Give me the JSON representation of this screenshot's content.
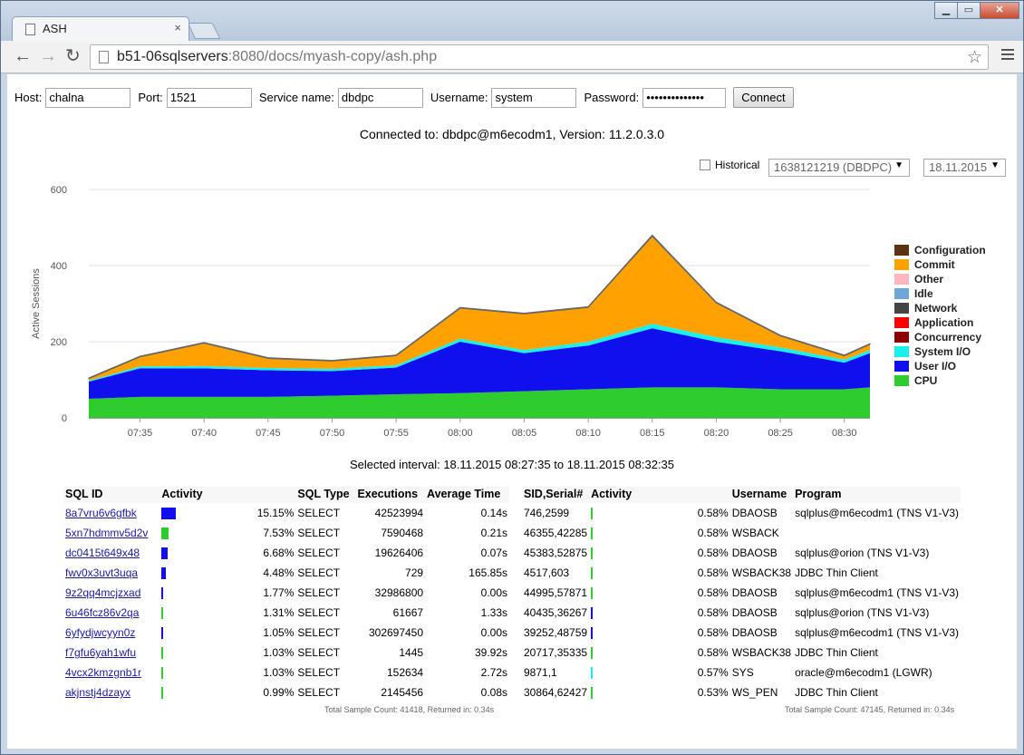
{
  "browser": {
    "tab_title": "ASH",
    "tab_close": "×",
    "url_host": "b51-06sqlservers",
    "url_rest": ":8080/docs/myash-copy/ash.php",
    "back": "←",
    "forward": "→",
    "reload": "↻",
    "star": "☆",
    "win_min": "▁",
    "win_max": "▭",
    "win_close": "✕"
  },
  "form": {
    "host_label": "Host:",
    "host_value": "chalna",
    "port_label": "Port:",
    "port_value": "1521",
    "service_label": "Service name:",
    "service_value": "dbdpc",
    "username_label": "Username:",
    "username_value": "system",
    "password_label": "Password:",
    "password_value": "••••••••••••••",
    "connect_label": "Connect"
  },
  "connection_text": "Connected to: dbdpc@m6ecodm1, Version: 11.2.0.3.0",
  "historical_label": "Historical",
  "dbid_select": "1638121219 (DBDPC)",
  "date_select": "18.11.2015",
  "select_arrow": "▼",
  "colors": {
    "cpu": "#2ecc2e",
    "user_io": "#1010ee",
    "system_io": "#19f0ee",
    "concurrency": "#8b0000",
    "application": "#ff0000",
    "network": "#444444",
    "idle": "#6ea6dc",
    "other": "#ffb6c1",
    "commit": "#ffa100",
    "configuration": "#5c3311"
  },
  "chart_data": {
    "type": "area",
    "ylabel": "Active Sessions",
    "ylim": [
      0,
      600
    ],
    "yticks": [
      "600",
      "400",
      "200",
      "0"
    ],
    "xticks": [
      "07:35",
      "07:40",
      "07:45",
      "07:50",
      "07:55",
      "08:00",
      "08:05",
      "08:10",
      "08:15",
      "08:20",
      "08:25",
      "08:30"
    ],
    "x_start": "07:31",
    "x_end": "08:32",
    "legend": [
      "Configuration",
      "Commit",
      "Other",
      "Idle",
      "Network",
      "Application",
      "Concurrency",
      "System I/O",
      "User I/O",
      "CPU"
    ],
    "series": [
      {
        "name": "CPU",
        "color": "#2ecc2e",
        "x": [
          "07:31",
          "07:35",
          "07:40",
          "07:45",
          "07:50",
          "07:55",
          "08:00",
          "08:05",
          "08:10",
          "08:15",
          "08:20",
          "08:25",
          "08:30",
          "08:32"
        ],
        "values": [
          50,
          55,
          55,
          55,
          58,
          62,
          65,
          70,
          75,
          80,
          80,
          75,
          75,
          80
        ]
      },
      {
        "name": "User I/O",
        "color": "#1010ee",
        "x": [
          "07:31",
          "07:35",
          "07:40",
          "07:45",
          "07:50",
          "07:55",
          "08:00",
          "08:05",
          "08:10",
          "08:15",
          "08:20",
          "08:25",
          "08:30",
          "08:32"
        ],
        "values": [
          45,
          75,
          75,
          70,
          65,
          70,
          135,
          100,
          115,
          155,
          120,
          100,
          70,
          90
        ]
      },
      {
        "name": "System I/O",
        "color": "#19f0ee",
        "x": [
          "07:31",
          "07:35",
          "07:40",
          "07:45",
          "07:50",
          "07:55",
          "08:00",
          "08:05",
          "08:10",
          "08:15",
          "08:20",
          "08:25",
          "08:30",
          "08:32"
        ],
        "values": [
          3,
          5,
          6,
          6,
          6,
          6,
          8,
          8,
          10,
          12,
          12,
          10,
          8,
          8
        ]
      },
      {
        "name": "Commit",
        "color": "#ffa100",
        "x": [
          "07:31",
          "07:35",
          "07:40",
          "07:45",
          "07:50",
          "07:55",
          "08:00",
          "08:05",
          "08:10",
          "08:15",
          "08:20",
          "08:25",
          "08:30",
          "08:32"
        ],
        "values": [
          5,
          25,
          60,
          25,
          20,
          25,
          80,
          95,
          90,
          230,
          90,
          30,
          10,
          15
        ]
      },
      {
        "name": "Configuration",
        "color": "#5c3311",
        "x": [
          "07:31",
          "07:35",
          "07:40",
          "07:45",
          "07:50",
          "07:55",
          "08:00",
          "08:05",
          "08:10",
          "08:15",
          "08:20",
          "08:25",
          "08:30",
          "08:32"
        ],
        "values": [
          2,
          2,
          2,
          2,
          2,
          2,
          2,
          2,
          2,
          3,
          2,
          2,
          2,
          2
        ]
      }
    ]
  },
  "interval_text": "Selected interval: 18.11.2015 08:27:35 to 18.11.2015 08:32:35",
  "sql_table": {
    "headers": [
      "SQL ID",
      "Activity",
      "",
      "SQL Type",
      "Executions",
      "Average Time"
    ],
    "rows": [
      {
        "id": "8a7vru6v6gfbk",
        "pct": 15.15,
        "pct_text": "15.15%",
        "type": "SELECT",
        "exec": "42523994",
        "avg": "0.14s",
        "color": "#1010ee"
      },
      {
        "id": "5xn7hdmmv5d2v",
        "pct": 7.53,
        "pct_text": "7.53%",
        "type": "SELECT",
        "exec": "7590468",
        "avg": "0.21s",
        "color": "#2ecc2e"
      },
      {
        "id": "dc0415t649x48",
        "pct": 6.68,
        "pct_text": "6.68%",
        "type": "SELECT",
        "exec": "19626406",
        "avg": "0.07s",
        "color": "#1010ee"
      },
      {
        "id": "fwv0x3uvt3uqa",
        "pct": 4.48,
        "pct_text": "4.48%",
        "type": "SELECT",
        "exec": "729",
        "avg": "165.85s",
        "color": "#1010ee"
      },
      {
        "id": "9z2qq4mcjzxad",
        "pct": 1.77,
        "pct_text": "1.77%",
        "type": "SELECT",
        "exec": "32986800",
        "avg": "0.00s",
        "color": "#1010ee"
      },
      {
        "id": "6u46fcz86v2qa",
        "pct": 1.31,
        "pct_text": "1.31%",
        "type": "SELECT",
        "exec": "61667",
        "avg": "1.33s",
        "color": "#2ecc2e"
      },
      {
        "id": "6yfydjwcyyn0z",
        "pct": 1.05,
        "pct_text": "1.05%",
        "type": "SELECT",
        "exec": "302697450",
        "avg": "0.00s",
        "color": "#1010ee"
      },
      {
        "id": "f7gfu6yah1wfu",
        "pct": 1.03,
        "pct_text": "1.03%",
        "type": "SELECT",
        "exec": "1445",
        "avg": "39.92s",
        "color": "#2ecc2e"
      },
      {
        "id": "4vcx2kmzgnb1r",
        "pct": 1.03,
        "pct_text": "1.03%",
        "type": "SELECT",
        "exec": "152634",
        "avg": "2.72s",
        "color": "#2ecc2e"
      },
      {
        "id": "akjnstj4dzayx",
        "pct": 0.99,
        "pct_text": "0.99%",
        "type": "SELECT",
        "exec": "2145456",
        "avg": "0.08s",
        "color": "#2ecc2e"
      }
    ],
    "footer": "Total Sample Count: 41418, Returned in: 0.34s"
  },
  "session_table": {
    "headers": [
      "SID,Serial#",
      "Activity",
      "",
      "Username",
      "Program"
    ],
    "rows": [
      {
        "sid": "746,2599",
        "pct": 0.58,
        "pct_text": "0.58%",
        "user": "DBAOSB",
        "program": "sqlplus@m6ecodm1 (TNS V1-V3)",
        "color": "#2ecc2e"
      },
      {
        "sid": "46355,42285",
        "pct": 0.58,
        "pct_text": "0.58%",
        "user": "WSBACK",
        "program": "",
        "color": "#2ecc2e"
      },
      {
        "sid": "45383,52875",
        "pct": 0.58,
        "pct_text": "0.58%",
        "user": "DBAOSB",
        "program": "sqlplus@orion (TNS V1-V3)",
        "color": "#2ecc2e"
      },
      {
        "sid": "4517,603",
        "pct": 0.58,
        "pct_text": "0.58%",
        "user": "WSBACK38",
        "program": "JDBC Thin Client",
        "color": "#2ecc2e"
      },
      {
        "sid": "44995,57871",
        "pct": 0.58,
        "pct_text": "0.58%",
        "user": "DBAOSB",
        "program": "sqlplus@m6ecodm1 (TNS V1-V3)",
        "color": "#2ecc2e"
      },
      {
        "sid": "40435,36267",
        "pct": 0.58,
        "pct_text": "0.58%",
        "user": "DBAOSB",
        "program": "sqlplus@orion (TNS V1-V3)",
        "color": "#1010ee"
      },
      {
        "sid": "39252,48759",
        "pct": 0.58,
        "pct_text": "0.58%",
        "user": "DBAOSB",
        "program": "sqlplus@m6ecodm1 (TNS V1-V3)",
        "color": "#1010ee"
      },
      {
        "sid": "20717,35335",
        "pct": 0.58,
        "pct_text": "0.58%",
        "user": "WSBACK38",
        "program": "JDBC Thin Client",
        "color": "#2ecc2e"
      },
      {
        "sid": "9871,1",
        "pct": 0.57,
        "pct_text": "0.57%",
        "user": "SYS",
        "program": "oracle@m6ecodm1 (LGWR)",
        "color": "#19f0ee"
      },
      {
        "sid": "30864,62427",
        "pct": 0.53,
        "pct_text": "0.53%",
        "user": "WS_PEN",
        "program": "JDBC Thin Client",
        "color": "#2ecc2e"
      }
    ],
    "footer": "Total Sample Count: 47145, Returned in: 0.34s"
  }
}
